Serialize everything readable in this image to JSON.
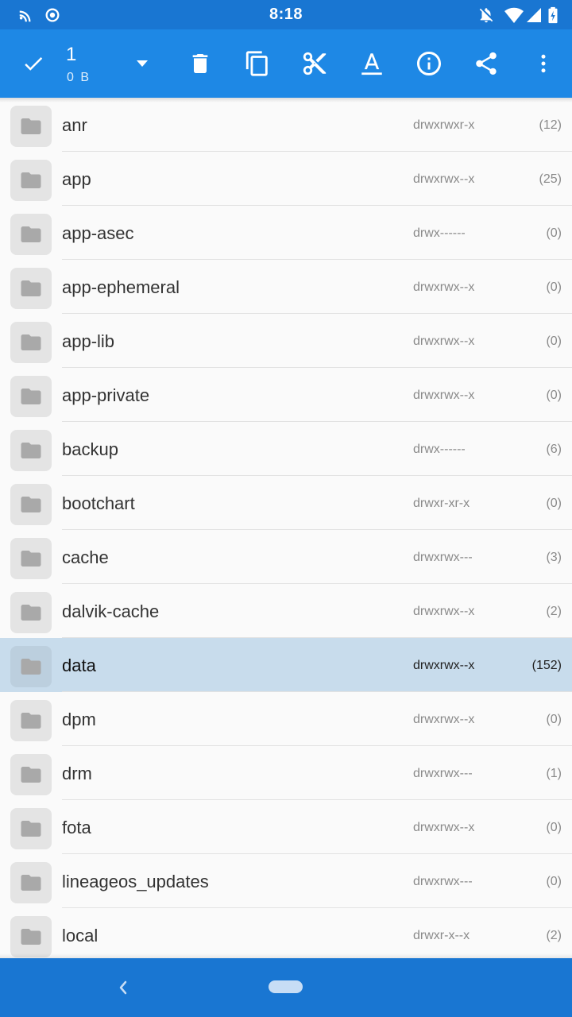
{
  "status_bar": {
    "time": "8:18",
    "icons_left": [
      "cast-icon",
      "record-icon"
    ],
    "icons_right": [
      "notifications-off-icon",
      "wifi-icon",
      "signal-icon",
      "battery-icon"
    ],
    "color": "#1976d2"
  },
  "toolbar": {
    "selected_count": "1",
    "selected_size": "0 B",
    "color": "#1e88e5",
    "actions": [
      "check-icon",
      "dropdown-icon",
      "delete-icon",
      "copy-icon",
      "cut-icon",
      "rename-icon",
      "info-icon",
      "share-icon",
      "more-icon"
    ]
  },
  "files": [
    {
      "name": "anr",
      "perm": "drwxrwxr-x",
      "count": "(12)",
      "selected": false
    },
    {
      "name": "app",
      "perm": "drwxrwx--x",
      "count": "(25)",
      "selected": false
    },
    {
      "name": "app-asec",
      "perm": "drwx------",
      "count": "(0)",
      "selected": false
    },
    {
      "name": "app-ephemeral",
      "perm": "drwxrwx--x",
      "count": "(0)",
      "selected": false
    },
    {
      "name": "app-lib",
      "perm": "drwxrwx--x",
      "count": "(0)",
      "selected": false
    },
    {
      "name": "app-private",
      "perm": "drwxrwx--x",
      "count": "(0)",
      "selected": false
    },
    {
      "name": "backup",
      "perm": "drwx------",
      "count": "(6)",
      "selected": false
    },
    {
      "name": "bootchart",
      "perm": "drwxr-xr-x",
      "count": "(0)",
      "selected": false
    },
    {
      "name": "cache",
      "perm": "drwxrwx---",
      "count": "(3)",
      "selected": false
    },
    {
      "name": "dalvik-cache",
      "perm": "drwxrwx--x",
      "count": "(2)",
      "selected": false
    },
    {
      "name": "data",
      "perm": "drwxrwx--x",
      "count": "(152)",
      "selected": true
    },
    {
      "name": "dpm",
      "perm": "drwxrwx--x",
      "count": "(0)",
      "selected": false
    },
    {
      "name": "drm",
      "perm": "drwxrwx---",
      "count": "(1)",
      "selected": false
    },
    {
      "name": "fota",
      "perm": "drwxrwx--x",
      "count": "(0)",
      "selected": false
    },
    {
      "name": "lineageos_updates",
      "perm": "drwxrwx---",
      "count": "(0)",
      "selected": false
    },
    {
      "name": "local",
      "perm": "drwxr-x--x",
      "count": "(2)",
      "selected": false
    }
  ],
  "nav_bar": {
    "icons": [
      "back-icon",
      "home-pill-icon"
    ],
    "color": "#1976d2"
  }
}
